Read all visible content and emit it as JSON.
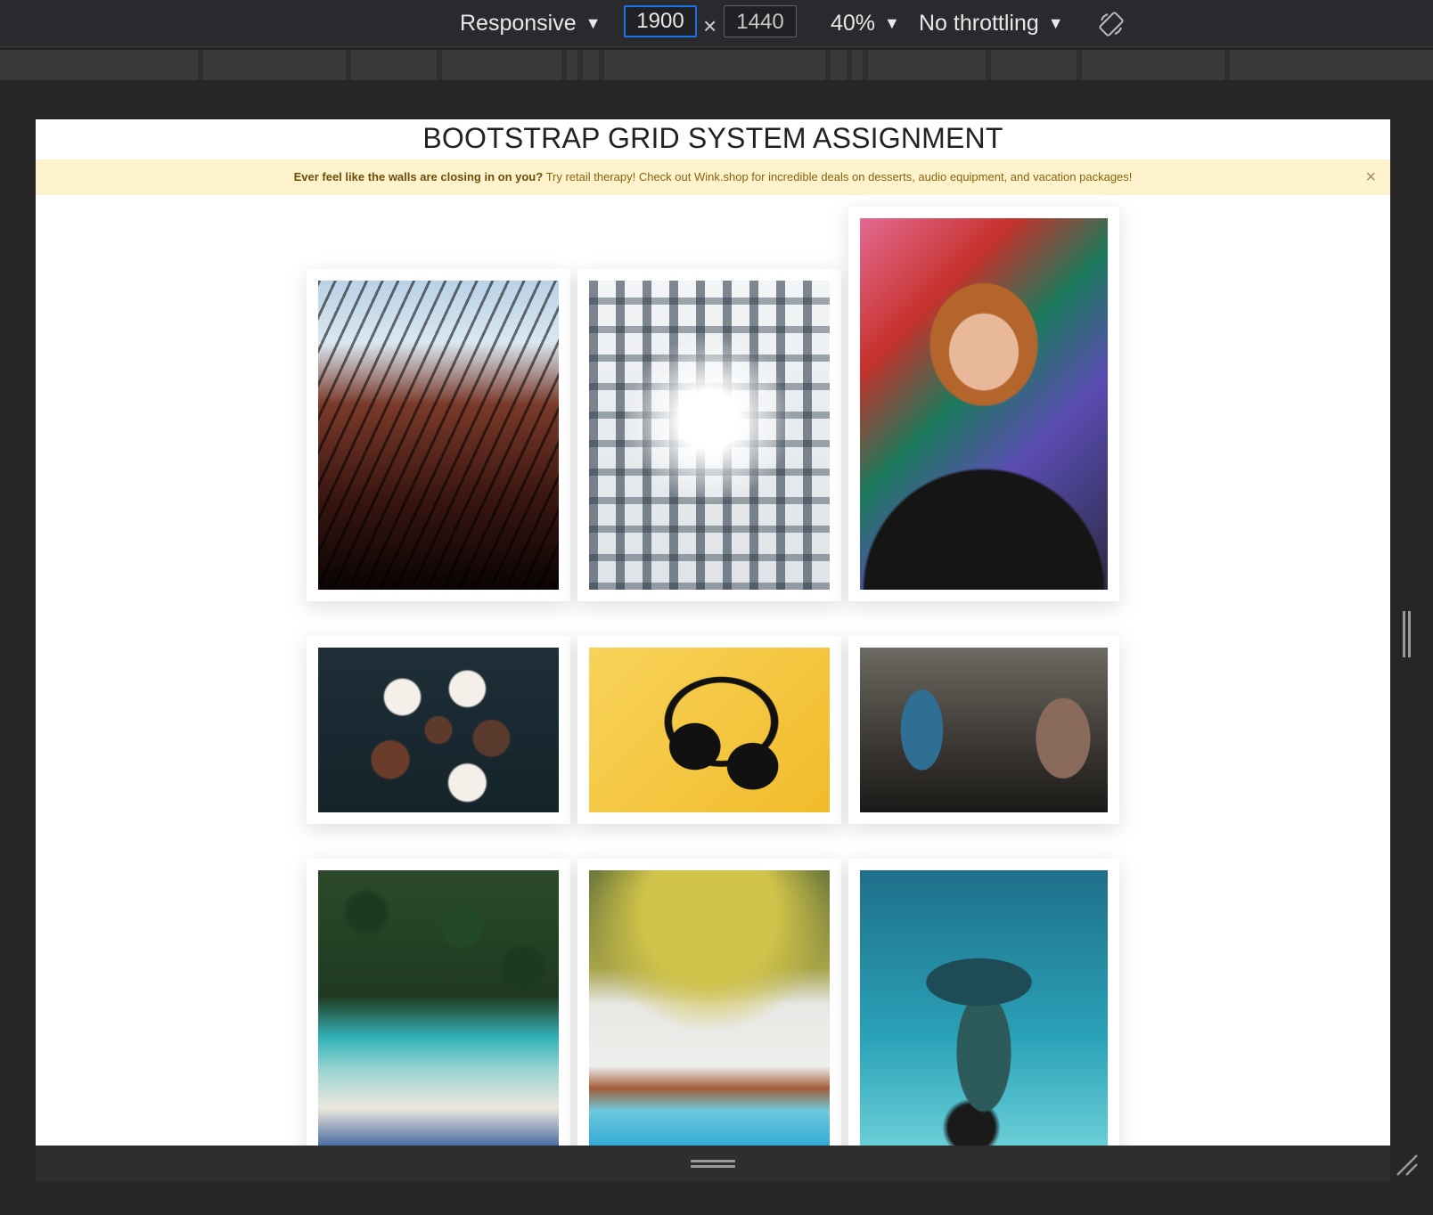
{
  "devtools": {
    "device_mode": "Responsive",
    "width_value": "1900",
    "height_value": "1440",
    "times": "×",
    "zoom": "40%",
    "throttling": "No throttling",
    "caret": "▼",
    "colors": {
      "toolbar_bg": "#292a2d",
      "active_border": "#1a73e8"
    }
  },
  "page": {
    "title": "BOOTSTRAP GRID SYSTEM ASSIGNMENT",
    "alert": {
      "bold_text": "Ever feel like the walls are closing in on you?",
      "text": " Try retail therapy! Check out Wink.shop for incredible deals on desserts, audio equipment, and vacation packages!",
      "close": "×",
      "colors": {
        "bg": "#fff3cd",
        "text": "#85640c"
      }
    },
    "gallery": [
      {
        "row": 1,
        "photos": [
          "curved-building-photo",
          "white-building-photo",
          "portrait-graffiti-photo"
        ]
      },
      {
        "row": 2,
        "photos": [
          "cupcakes-photo",
          "headphones-photo",
          "graffiti-headphones-photo"
        ]
      },
      {
        "row": 3,
        "photos": [
          "palm-beach-photo",
          "aerial-beach-photo",
          "reef-photo"
        ]
      }
    ]
  }
}
